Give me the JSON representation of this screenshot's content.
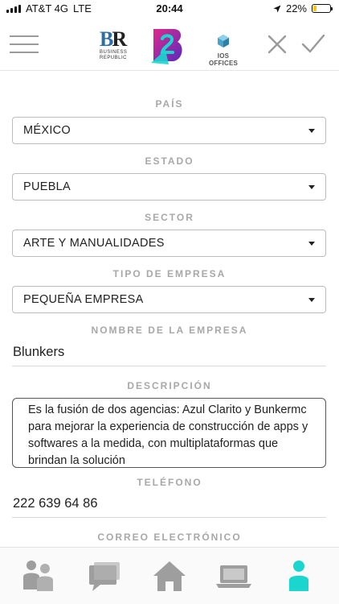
{
  "status_bar": {
    "carrier": "AT&T 4G",
    "network": "LTE",
    "time": "20:44",
    "battery": "22%",
    "battery_level": 0.22,
    "battery_color": "#f5c518"
  },
  "header": {
    "menu_icon": "hamburger-menu-icon",
    "logos": {
      "br_mark_b": "B",
      "br_mark_r": "R",
      "br_line1": "BUSINESS",
      "br_line2": "REPUBLIC",
      "ios": "IOS OFFICES"
    },
    "close_icon": "close-icon",
    "check_icon": "check-icon"
  },
  "form": {
    "pais": {
      "label": "PAÍS",
      "value": "MÉXICO"
    },
    "estado": {
      "label": "ESTADO",
      "value": "PUEBLA"
    },
    "sector": {
      "label": "SECTOR",
      "value": "ARTE Y MANUALIDADES"
    },
    "tipo_empresa": {
      "label": "TIPO DE EMPRESA",
      "value": "PEQUEÑA EMPRESA"
    },
    "nombre_empresa": {
      "label": "NOMBRE DE LA EMPRESA",
      "value": "Blunkers"
    },
    "descripcion": {
      "label": "DESCRIPCIÓN",
      "value": "Es la fusión de dos agencias: Azul Clarito y Bunkermc para mejorar la experiencia de construcción de apps y softwares a la medida, con multiplataformas que brindan la solución"
    },
    "telefono": {
      "label": "TELÉFONO",
      "value": "222 639 64 86"
    },
    "correo": {
      "label": "CORREO ELECTRÓNICO"
    }
  },
  "tab_bar": {
    "tabs": [
      {
        "icon": "people-icon",
        "active": false
      },
      {
        "icon": "chat-icon",
        "active": false
      },
      {
        "icon": "home-icon",
        "active": false
      },
      {
        "icon": "laptop-icon",
        "active": false
      },
      {
        "icon": "person-icon",
        "active": true
      }
    ]
  },
  "colors": {
    "accent": "#1ad6cf",
    "inactive_icon": "#9e9e9e",
    "label": "#a8a8a8",
    "logo_blue": "#2d6ea8",
    "logo_purple": "#5b2bbf",
    "logo_pink": "#e0288a"
  }
}
